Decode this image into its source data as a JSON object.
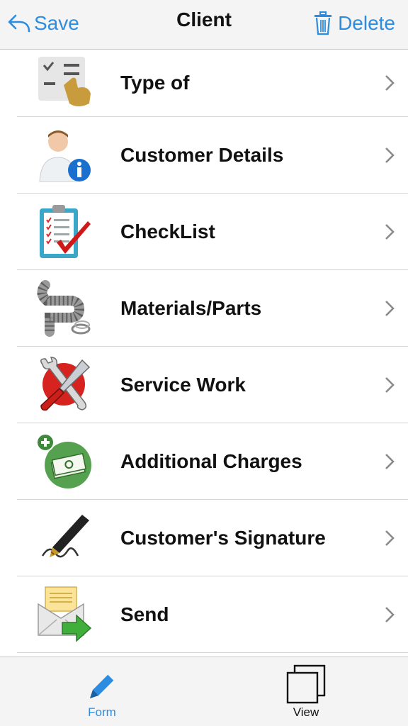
{
  "header": {
    "back_label": "Save",
    "title": "Client",
    "delete_label": "Delete",
    "accent_color": "#2e8ce0"
  },
  "menu": {
    "items": [
      {
        "label": "Type of",
        "icon": "checklist-hand-icon"
      },
      {
        "label": "Customer Details",
        "icon": "user-info-icon"
      },
      {
        "label": "CheckList",
        "icon": "clipboard-check-icon"
      },
      {
        "label": "Materials/Parts",
        "icon": "pipe-parts-icon"
      },
      {
        "label": "Service Work",
        "icon": "wrench-screwdriver-icon"
      },
      {
        "label": "Additional Charges",
        "icon": "money-add-icon"
      },
      {
        "label": "Customer's Signature",
        "icon": "pen-signature-icon"
      },
      {
        "label": "Send",
        "icon": "envelope-send-icon"
      }
    ]
  },
  "tabs": {
    "form_label": "Form",
    "view_label": "View",
    "active": "Form"
  }
}
